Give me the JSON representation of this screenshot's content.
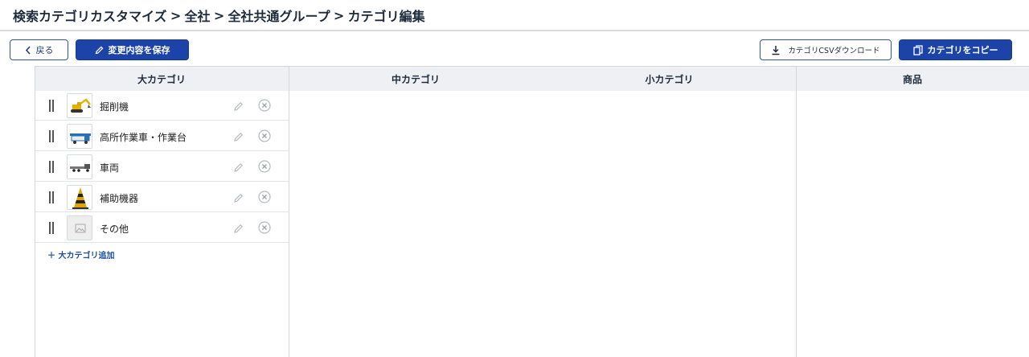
{
  "breadcrumb": {
    "items": [
      "検索カテゴリカスタマイズ",
      "全社",
      "全社共通グループ",
      "カテゴリ編集"
    ],
    "separator": ">"
  },
  "toolbar": {
    "back_label": "戻る",
    "save_label": "変更内容を保存",
    "csv_download_label": "カテゴリCSVダウンロード",
    "copy_label": "カテゴリをコピー"
  },
  "columns": {
    "large": "大カテゴリ",
    "medium": "中カテゴリ",
    "small": "小カテゴリ",
    "product": "商品"
  },
  "large_categories": [
    {
      "label": "掘削機",
      "icon": "excavator-image"
    },
    {
      "label": "高所作業車・作業台",
      "icon": "aerial-work-truck-image"
    },
    {
      "label": "車両",
      "icon": "truck-image"
    },
    {
      "label": "補助機器",
      "icon": "traffic-cone-image"
    },
    {
      "label": "その他",
      "icon": "image-placeholder-icon"
    }
  ],
  "add_large_category_label": "＋ 大カテゴリ追加",
  "colors": {
    "primary": "#1c44a8",
    "header_bg": "#eef0f3",
    "link": "#1f4ea3"
  }
}
